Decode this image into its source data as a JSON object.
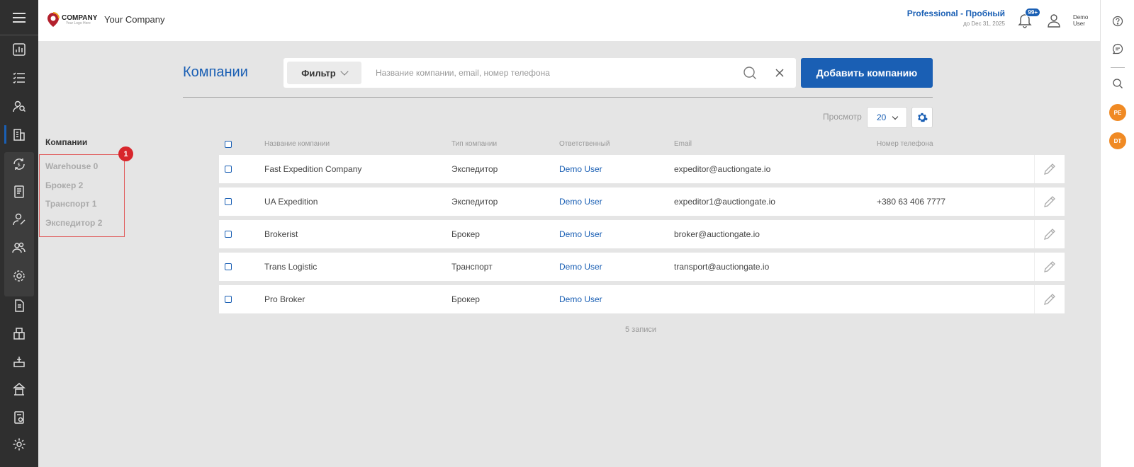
{
  "header": {
    "logo_text": "COMPANY",
    "logo_sub": "Your Logo Here",
    "company_name": "Your Company",
    "plan": "Professional - Пробный",
    "plan_expiry": "до Dec 31, 2025",
    "notifications_badge": "99+",
    "user_name_line1": "Demo",
    "user_name_line2": "User"
  },
  "page": {
    "title": "Компании",
    "filter_label": "Фильтр",
    "search_placeholder": "Название компании, email, номер телефона",
    "add_button": "Добавить компанию",
    "view_label": "Просмотр",
    "view_value": "20",
    "records_count": "5 записи"
  },
  "side": {
    "title": "Компании",
    "marker": "1",
    "items": [
      {
        "label": "Warehouse 0"
      },
      {
        "label": "Брокер 2"
      },
      {
        "label": "Транспорт 1"
      },
      {
        "label": "Экспедитор 2"
      }
    ]
  },
  "table": {
    "headers": [
      "Название компании",
      "Тип компании",
      "Ответственный",
      "Email",
      "Номер телефона"
    ],
    "rows": [
      {
        "name": "Fast Expedition Company",
        "type": "Экспедитор",
        "owner": "Demo User",
        "email": "expeditor@auctiongate.io",
        "phone": ""
      },
      {
        "name": "UA Expedition",
        "type": "Экспедитор",
        "owner": "Demo User",
        "email": "expeditor1@auctiongate.io",
        "phone": "+380 63 406 7777"
      },
      {
        "name": "Brokerist",
        "type": "Брокер",
        "owner": "Demo User",
        "email": "broker@auctiongate.io",
        "phone": ""
      },
      {
        "name": "Trans Logistic",
        "type": "Транспорт",
        "owner": "Demo User",
        "email": "transport@auctiongate.io",
        "phone": ""
      },
      {
        "name": "Pro Broker",
        "type": "Брокер",
        "owner": "Demo User",
        "email": "",
        "phone": ""
      }
    ]
  },
  "right_rail": {
    "avatars": [
      "PE",
      "DT"
    ]
  },
  "colors": {
    "accent": "#1a5fb4",
    "rail": "#2f2f2f",
    "avatar": "#f08a24",
    "marker": "#d8262c"
  }
}
